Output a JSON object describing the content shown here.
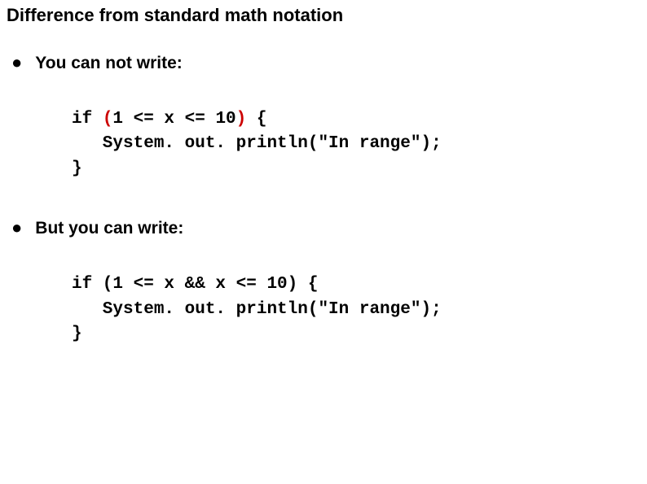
{
  "title": "Difference from standard math notation",
  "bullets": [
    {
      "text": "You can not write:"
    },
    {
      "text": "But you can write:"
    }
  ],
  "code1": {
    "if_keyword": "if ",
    "lparen": "(",
    "expr": "1 <= x <= 10",
    "rparen": ")",
    "brace_open": " {",
    "line2": "   System. out. println(\"In range\");",
    "line3": "}"
  },
  "code2": {
    "line1": "if (1 <= x && x <= 10) {",
    "line2": "   System. out. println(\"In range\");",
    "line3": "}"
  }
}
